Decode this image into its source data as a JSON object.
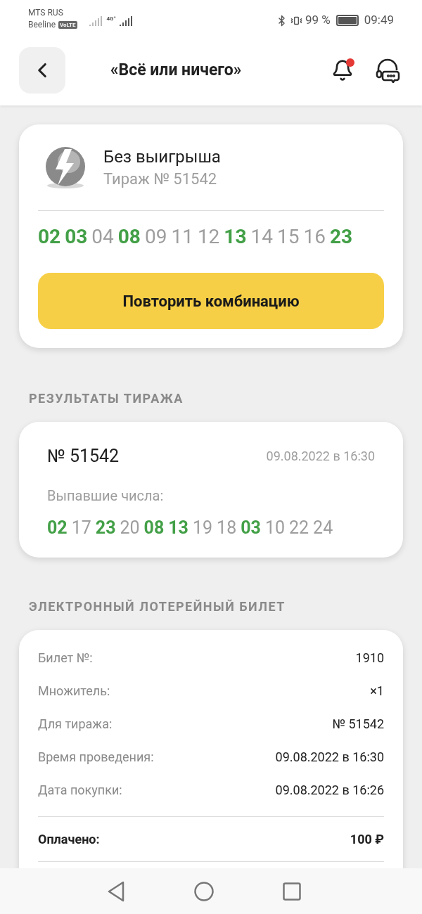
{
  "status_bar": {
    "carrier_1": "MTS RUS",
    "carrier_2": "Beeline",
    "volte": "VoLTE",
    "network": "4G⁺",
    "battery_percent": "99 %",
    "time": "09:49"
  },
  "header": {
    "title": "«Всё или ничего»",
    "notification_badge": true
  },
  "result_card": {
    "status": "Без выигрыша",
    "draw": "Тираж № 51542",
    "numbers": [
      {
        "value": "02",
        "matched": true
      },
      {
        "value": "03",
        "matched": true
      },
      {
        "value": "04",
        "matched": false
      },
      {
        "value": "08",
        "matched": true
      },
      {
        "value": "09",
        "matched": false
      },
      {
        "value": "11",
        "matched": false
      },
      {
        "value": "12",
        "matched": false
      },
      {
        "value": "13",
        "matched": true
      },
      {
        "value": "14",
        "matched": false
      },
      {
        "value": "15",
        "matched": false
      },
      {
        "value": "16",
        "matched": false
      },
      {
        "value": "23",
        "matched": true
      }
    ],
    "button": "Повторить комбинацию"
  },
  "draw_results": {
    "heading": "РЕЗУЛЬТАТЫ ТИРАЖА",
    "number": "№ 51542",
    "date": "09.08.2022 в 16:30",
    "label": "Выпавшие числа:",
    "numbers": [
      {
        "value": "02",
        "matched": true
      },
      {
        "value": "17",
        "matched": false
      },
      {
        "value": "23",
        "matched": true
      },
      {
        "value": "20",
        "matched": false
      },
      {
        "value": "08",
        "matched": true
      },
      {
        "value": "13",
        "matched": true
      },
      {
        "value": "19",
        "matched": false
      },
      {
        "value": "18",
        "matched": false
      },
      {
        "value": "03",
        "matched": true
      },
      {
        "value": "10",
        "matched": false
      },
      {
        "value": "22",
        "matched": false
      },
      {
        "value": "24",
        "matched": false
      }
    ]
  },
  "ticket": {
    "heading": "ЭЛЕКТРОННЫЙ ЛОТЕРЕЙНЫЙ БИЛЕТ",
    "rows": [
      {
        "kind": "detail",
        "label": "Билет №:",
        "value": "1910"
      },
      {
        "kind": "detail",
        "label": "Множитель:",
        "value": "×1"
      },
      {
        "kind": "detail",
        "label": "Для тиража:",
        "value": "№ 51542"
      },
      {
        "kind": "detail",
        "label": "Время проведения:",
        "value": "09.08.2022 в 16:30"
      },
      {
        "kind": "detail",
        "label": "Дата покупки:",
        "value": "09.08.2022 в 16:26"
      },
      {
        "kind": "total",
        "label": "Оплачено:",
        "value": "100 ₽"
      }
    ]
  }
}
